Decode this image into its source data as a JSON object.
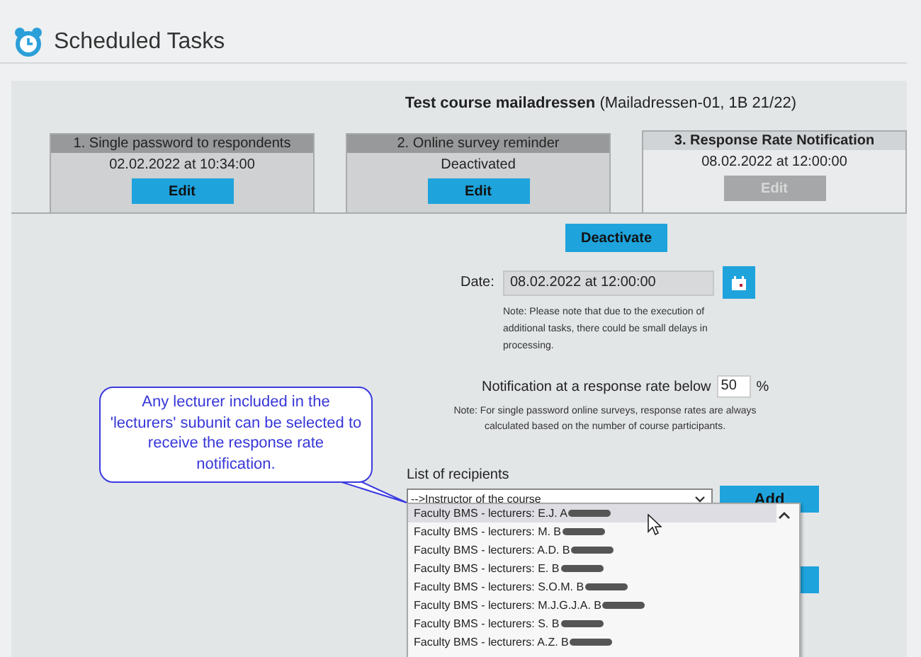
{
  "page": {
    "title": "Scheduled Tasks"
  },
  "course": {
    "name": "Test course mailadressen",
    "code": "(Mailadressen-01, 1B 21/22)"
  },
  "tabs": [
    {
      "title": "1. Single password to respondents",
      "value": "02.02.2022 at 10:34:00",
      "button": "Edit",
      "selected": false,
      "disabled": false
    },
    {
      "title": "2. Online survey reminder",
      "value": "Deactivated",
      "button": "Edit",
      "selected": false,
      "disabled": false
    },
    {
      "title": "3. Response Rate Notification",
      "value": "08.02.2022 at 12:00:00",
      "button": "Edit",
      "selected": true,
      "disabled": true
    }
  ],
  "form": {
    "deactivate_button": "Deactivate",
    "date_label": "Date:",
    "date_value": "08.02.2022 at 12:00:00",
    "date_note": "Note: Please note that due to the execution of additional tasks, there could be small delays in processing.",
    "rate_label": "Notification at a response rate below",
    "rate_value": "50",
    "rate_unit": "%",
    "rate_note": "Note: For single password online surveys, response rates are always calculated based on the number of course participants.",
    "recipients_label": "List of recipients",
    "recipients_value": "-->Instructor of the course",
    "add_button": "Add"
  },
  "dropdown_items": [
    {
      "text": "Faculty BMS - lecturers: E.J. A",
      "highlighted": true
    },
    {
      "text": "Faculty BMS - lecturers: M. B",
      "highlighted": false
    },
    {
      "text": "Faculty BMS - lecturers: A.D. B",
      "highlighted": false
    },
    {
      "text": "Faculty BMS - lecturers: E. B",
      "highlighted": false
    },
    {
      "text": "Faculty BMS - lecturers: S.O.M. B",
      "highlighted": false
    },
    {
      "text": "Faculty BMS - lecturers: M.J.G.J.A. B",
      "highlighted": false
    },
    {
      "text": "Faculty BMS - lecturers: S. B",
      "highlighted": false
    },
    {
      "text": "Faculty BMS - lecturers: A.Z. B",
      "highlighted": false
    }
  ],
  "callout": {
    "text": "Any lecturer included in the 'lecturers' subunit can be selected to receive the response rate notification."
  }
}
